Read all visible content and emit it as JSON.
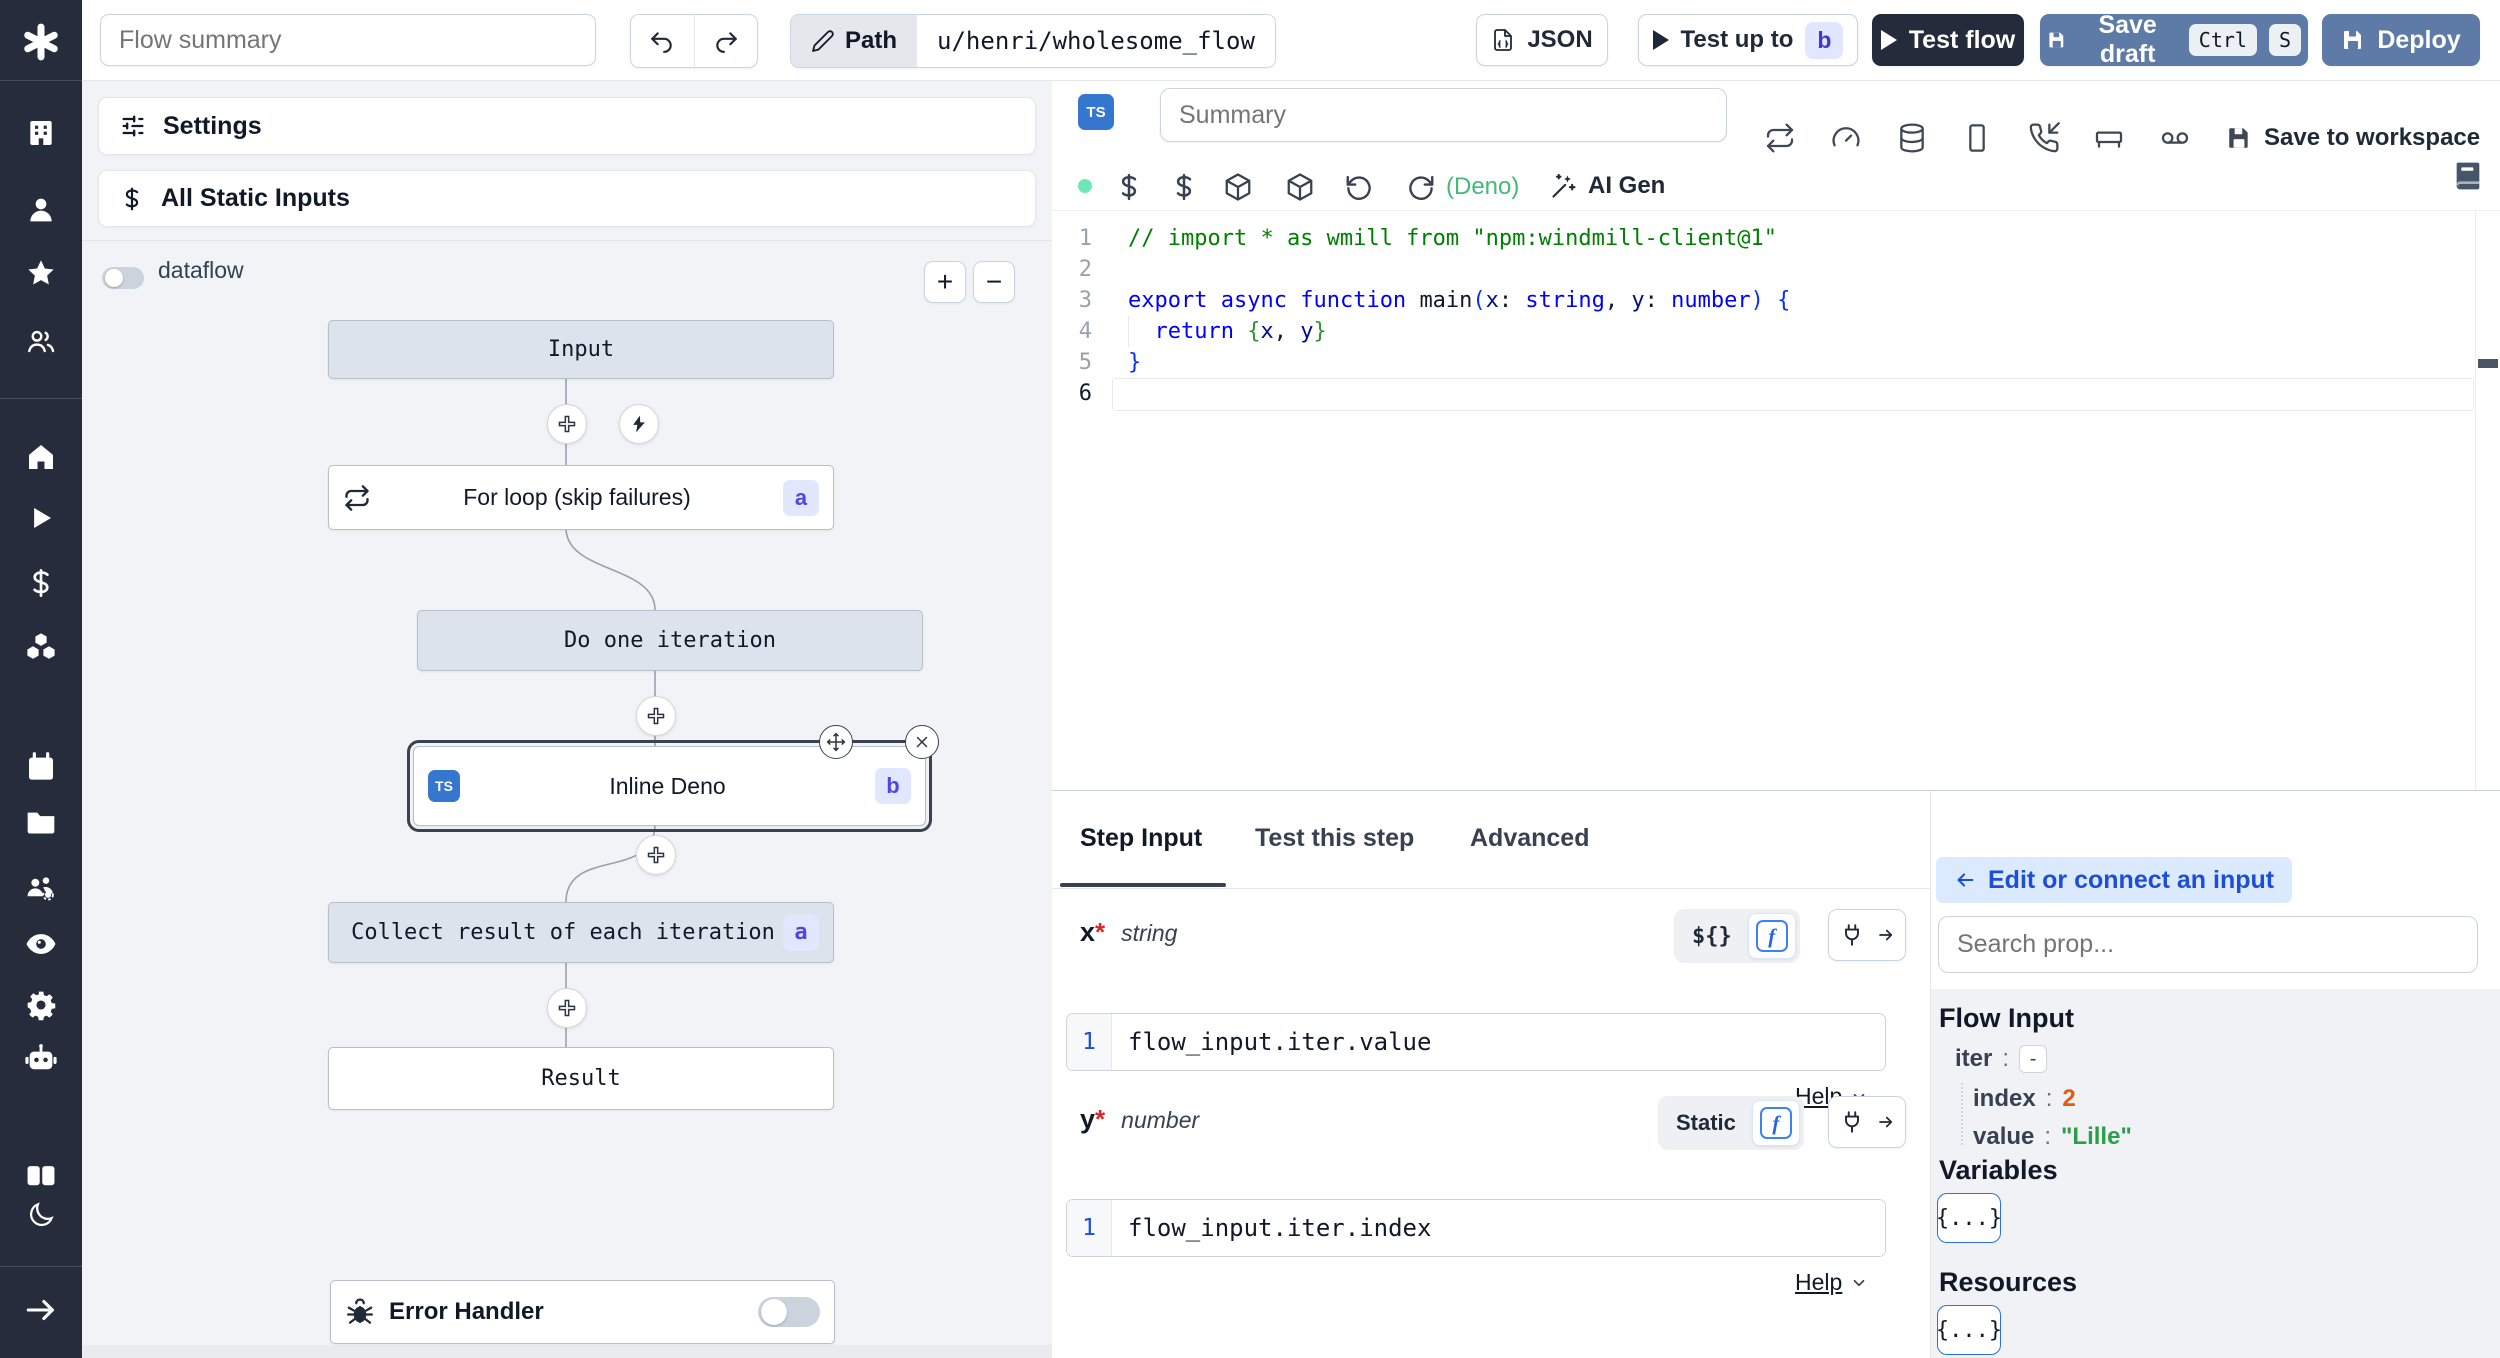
{
  "colors": {
    "accent": "#3b82f6",
    "sidebar_bg": "#262c3b",
    "panel_bg": "#f1f3f6",
    "node_virtual_bg": "#dde3ec",
    "badge_bg": "#e0e7ff",
    "badge_text": "#4f46e5",
    "action_button_blue": "#5d7ba6",
    "dark_button": "#242b3a",
    "deno_green": "#44b978",
    "status_green": "#6ee7b7",
    "value_orange": "#e8590c",
    "value_green": "#2b9e4a",
    "edit_pill_bg": "#dbeafe",
    "edit_pill_text": "#1d4ed8",
    "ts_blue": "#3577cf"
  },
  "topbar": {
    "flow_summary_placeholder": "Flow summary",
    "path_label": "Path",
    "path_value": "u/henri/wholesome_flow",
    "json_label": "JSON",
    "test_up_to_label": "Test up to",
    "test_up_to_badge": "b",
    "test_flow_label": "Test flow",
    "save_draft_label": "Save draft",
    "save_draft_kbd": [
      "Ctrl",
      "S"
    ],
    "deploy_label": "Deploy"
  },
  "flow_panel": {
    "settings_label": "Settings",
    "static_inputs_label": "All Static Inputs",
    "dataflow_label": "dataflow",
    "zoom_in": "+",
    "zoom_out": "−",
    "error_handler_label": "Error Handler"
  },
  "graph": {
    "input": {
      "label": "Input"
    },
    "forloop": {
      "label": "For loop (skip failures)",
      "badge": "a"
    },
    "do_one": {
      "label": "Do one iteration"
    },
    "inline": {
      "label": "Inline Deno",
      "badge": "b",
      "lang": "TS"
    },
    "collect": {
      "label": "Collect result of each iteration",
      "badge": "a"
    },
    "result": {
      "label": "Result"
    }
  },
  "editor": {
    "lang_badge": "TS",
    "summary_placeholder": "Summary",
    "runtime_label": "(Deno)",
    "ai_gen_label": "AI Gen",
    "save_to_workspace_label": "Save to workspace",
    "line_numbers": [
      "1",
      "2",
      "3",
      "4",
      "5",
      "6"
    ],
    "code_lines": [
      [
        {
          "t": "// import * as wmill from \"npm:windmill-client@1\"",
          "c": "comment"
        }
      ],
      [],
      [
        {
          "t": "export",
          "c": "kw"
        },
        {
          "t": " "
        },
        {
          "t": "async",
          "c": "kw"
        },
        {
          "t": " "
        },
        {
          "t": "function",
          "c": "kw"
        },
        {
          "t": " "
        },
        {
          "t": "main",
          "c": "fn"
        },
        {
          "t": "(",
          "c": "pa"
        },
        {
          "t": "x",
          "c": "pr"
        },
        {
          "t": ": "
        },
        {
          "t": "string",
          "c": "kw"
        },
        {
          "t": ", "
        },
        {
          "t": "y",
          "c": "pr"
        },
        {
          "t": ": "
        },
        {
          "t": "number",
          "c": "kw"
        },
        {
          "t": ")",
          "c": "pa"
        },
        {
          "t": " "
        },
        {
          "t": "{",
          "c": "pa"
        }
      ],
      [
        {
          "t": "  "
        },
        {
          "t": "return",
          "c": "kw"
        },
        {
          "t": " "
        },
        {
          "t": "{",
          "c": "br2"
        },
        {
          "t": "x",
          "c": "pr"
        },
        {
          "t": ", "
        },
        {
          "t": "y",
          "c": "pr"
        },
        {
          "t": "}",
          "c": "br2"
        }
      ],
      [
        {
          "t": "}",
          "c": "pa"
        }
      ],
      []
    ]
  },
  "step_panel": {
    "tabs": [
      "Step Input",
      "Test this step",
      "Advanced"
    ],
    "fn_icon": "f",
    "x_field": {
      "name": "x",
      "required_mark": "*",
      "type": "string",
      "mode_toggle": "${}",
      "code_line_number": "1",
      "code": "flow_input.iter.value",
      "help_label": "Help"
    },
    "y_field": {
      "name": "y",
      "required_mark": "*",
      "type": "number",
      "mode_toggle": "Static",
      "code_line_number": "1",
      "code": "flow_input.iter.index",
      "help_label": "Help"
    }
  },
  "connect_panel": {
    "back_label": "Edit or connect an input",
    "search_placeholder": "Search prop...",
    "flow_input_title": "Flow Input",
    "tree": {
      "iter_label": "iter",
      "collapse_label": "-",
      "index_label": "index",
      "index_value": "2",
      "value_label": "value",
      "value_value": "\"Lille\""
    },
    "variables_title": "Variables",
    "variables_button": "{...}",
    "resources_title": "Resources",
    "resources_button": "{...}"
  }
}
